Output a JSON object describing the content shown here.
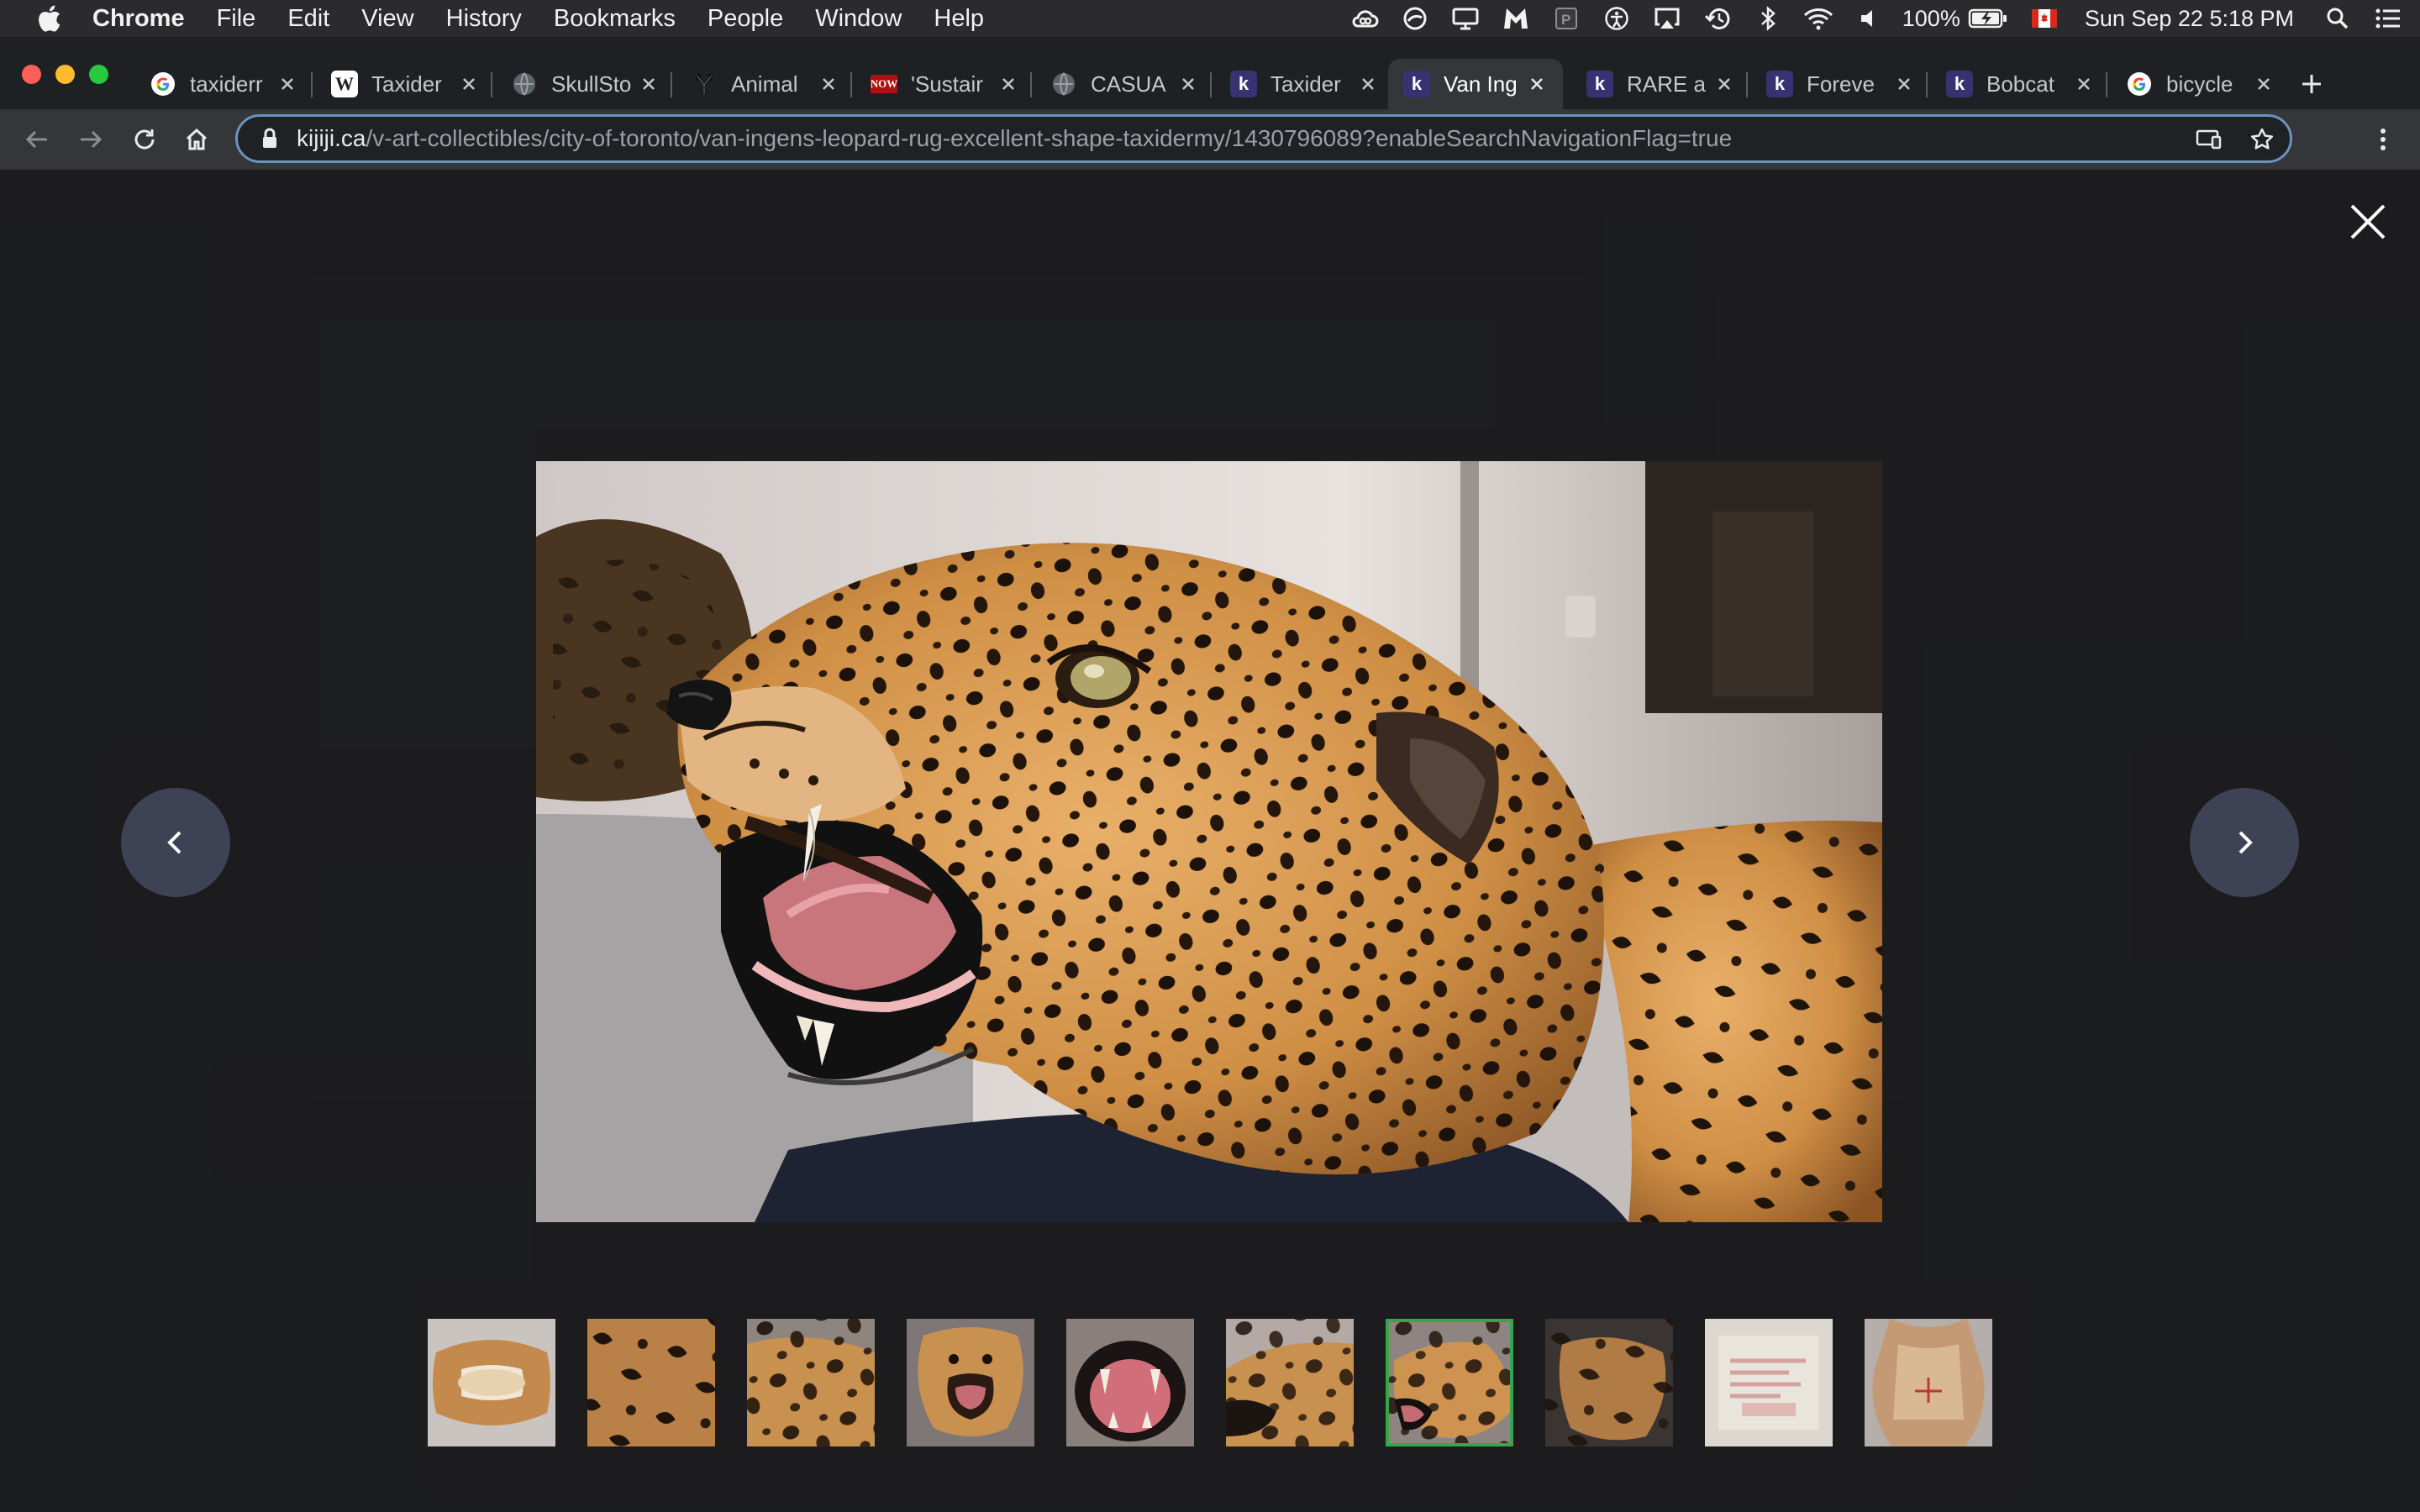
{
  "menubar": {
    "app_name": "Chrome",
    "menus": [
      "File",
      "Edit",
      "View",
      "History",
      "Bookmarks",
      "People",
      "Window",
      "Help"
    ],
    "battery": "100%",
    "datetime": "Sun Sep 22  5:18 PM"
  },
  "tabs": [
    {
      "title": "taxiderr",
      "favicon": "google-icon",
      "active": false
    },
    {
      "title": "Taxider",
      "favicon": "wikipedia-icon",
      "active": false
    },
    {
      "title": "SkullSto",
      "favicon": "globe-icon",
      "active": false
    },
    {
      "title": "Animal",
      "favicon": "antlers-icon",
      "active": false
    },
    {
      "title": "'Sustair",
      "favicon": "now-icon",
      "active": false
    },
    {
      "title": "CASUA",
      "favicon": "globe-icon",
      "active": false
    },
    {
      "title": "Taxider",
      "favicon": "kijiji-icon",
      "active": false
    },
    {
      "title": "Van Ing",
      "favicon": "kijiji-icon",
      "active": true
    },
    {
      "title": "RARE a",
      "favicon": "kijiji-icon",
      "active": false
    },
    {
      "title": "Foreve",
      "favicon": "kijiji-icon",
      "active": false
    },
    {
      "title": "Bobcat",
      "favicon": "kijiji-icon",
      "active": false
    },
    {
      "title": "bicycle",
      "favicon": "google-icon",
      "active": false
    }
  ],
  "address_bar": {
    "host": "kijiji.ca",
    "path": "/v-art-collectibles/city-of-toronto/van-ingens-leopard-rug-excellent-shape-taxidermy/1430796089?enableSearchNavigationFlag=true"
  },
  "gallery": {
    "image_subject": "leopard head taxidermy rug, side view, mouth open",
    "thumbnail_count": 10,
    "active_thumbnail": 7,
    "thumbnails": [
      {
        "subject": "leopard rug full view"
      },
      {
        "subject": "spotted fur close-up"
      },
      {
        "subject": "leopard head top view"
      },
      {
        "subject": "leopard face front snarl"
      },
      {
        "subject": "open mouth teeth close-up"
      },
      {
        "subject": "leopard head angled"
      },
      {
        "subject": "leopard head side view"
      },
      {
        "subject": "leopard head rear angle"
      },
      {
        "subject": "label / certificate paper"
      },
      {
        "subject": "leopard rug underside"
      }
    ]
  },
  "colors": {
    "accent_active_thumb": "#37a64a",
    "arrow_button_bg": "#3d4255",
    "omnibox_border": "#6a93bf"
  }
}
